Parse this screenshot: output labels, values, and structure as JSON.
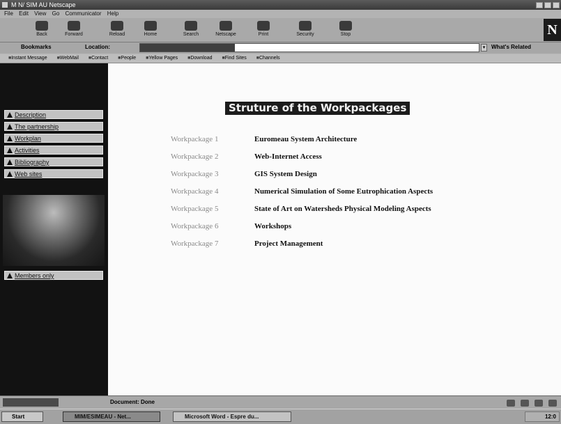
{
  "window": {
    "title": "M N/ SIM AU Netscape"
  },
  "menu": [
    "File",
    "Edit",
    "View",
    "Go",
    "Communicator",
    "Help"
  ],
  "toolbar": [
    {
      "label": "Back",
      "icon": "back-arrow-icon"
    },
    {
      "label": "Forward",
      "icon": "forward-arrow-icon"
    },
    {
      "label": "Reload",
      "icon": "reload-icon"
    },
    {
      "label": "Home",
      "icon": "home-icon"
    },
    {
      "label": "Search",
      "icon": "search-icon"
    },
    {
      "label": "Netscape",
      "icon": "netscape-icon"
    },
    {
      "label": "Print",
      "icon": "print-icon"
    },
    {
      "label": "Security",
      "icon": "security-icon"
    },
    {
      "label": "Stop",
      "icon": "stop-icon"
    }
  ],
  "location": {
    "bookmarks": "Bookmarks",
    "label": "Location:",
    "url": "",
    "whats_related": "What's Related"
  },
  "personal_toolbar": [
    "Instant Message",
    "WebMail",
    "Contact",
    "People",
    "Yellow Pages",
    "Download",
    "Find Sites",
    "Channels"
  ],
  "sidebar": {
    "header": "",
    "items": [
      {
        "label": "Description"
      },
      {
        "label": "The partnership"
      },
      {
        "label": "Workplan"
      },
      {
        "label": "Activities"
      },
      {
        "label": "Bibliography"
      },
      {
        "label": "Web sites"
      }
    ],
    "members": "Members only"
  },
  "page": {
    "title": "Struture of the Workpackages",
    "workpackages": [
      {
        "label": "Workpackage 1",
        "name": "Euromeau System Architecture"
      },
      {
        "label": "Workpackage 2",
        "name": "Web-Internet Access"
      },
      {
        "label": "Workpackage 3",
        "name": "GIS System Design"
      },
      {
        "label": "Workpackage 4",
        "name": "Numerical Simulation of Some Eutrophication Aspects"
      },
      {
        "label": "Workpackage 5",
        "name": "State of Art on Watersheds Physical Modeling Aspects"
      },
      {
        "label": "Workpackage 6",
        "name": "Workshops"
      },
      {
        "label": "Workpackage 7",
        "name": "Project Management"
      }
    ]
  },
  "status": {
    "text": "Document: Done"
  },
  "taskbar": {
    "start": "Start",
    "tasks": [
      {
        "label": "MIM/ESIMEAU - Net..."
      },
      {
        "label": "Microsoft Word - Espre du..."
      }
    ],
    "clock": "12:0"
  }
}
